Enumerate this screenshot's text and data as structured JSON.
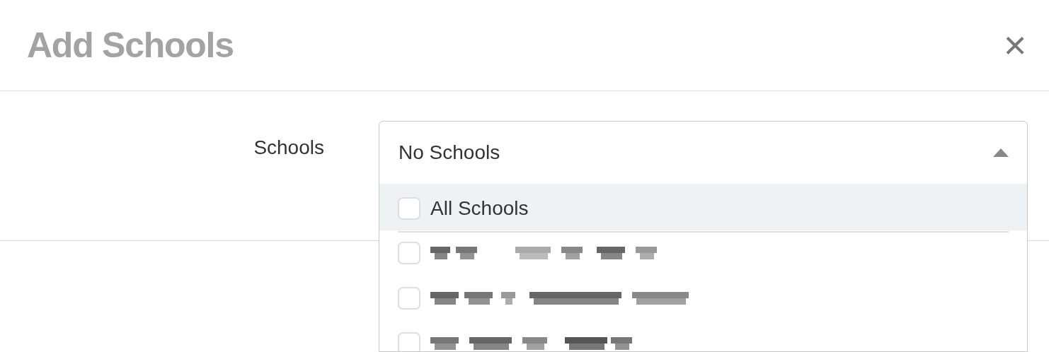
{
  "dialog": {
    "title": "Add Schools",
    "close_icon": "×"
  },
  "field": {
    "label": "Schools",
    "value": "No Schools",
    "expanded": true
  },
  "options": [
    {
      "kind": "text",
      "label": "All Schools",
      "checked": false,
      "highlighted": true
    },
    {
      "kind": "redacted",
      "checked": false,
      "highlighted": false
    },
    {
      "kind": "redacted",
      "checked": false,
      "highlighted": false
    },
    {
      "kind": "redacted",
      "checked": false,
      "highlighted": false
    }
  ]
}
